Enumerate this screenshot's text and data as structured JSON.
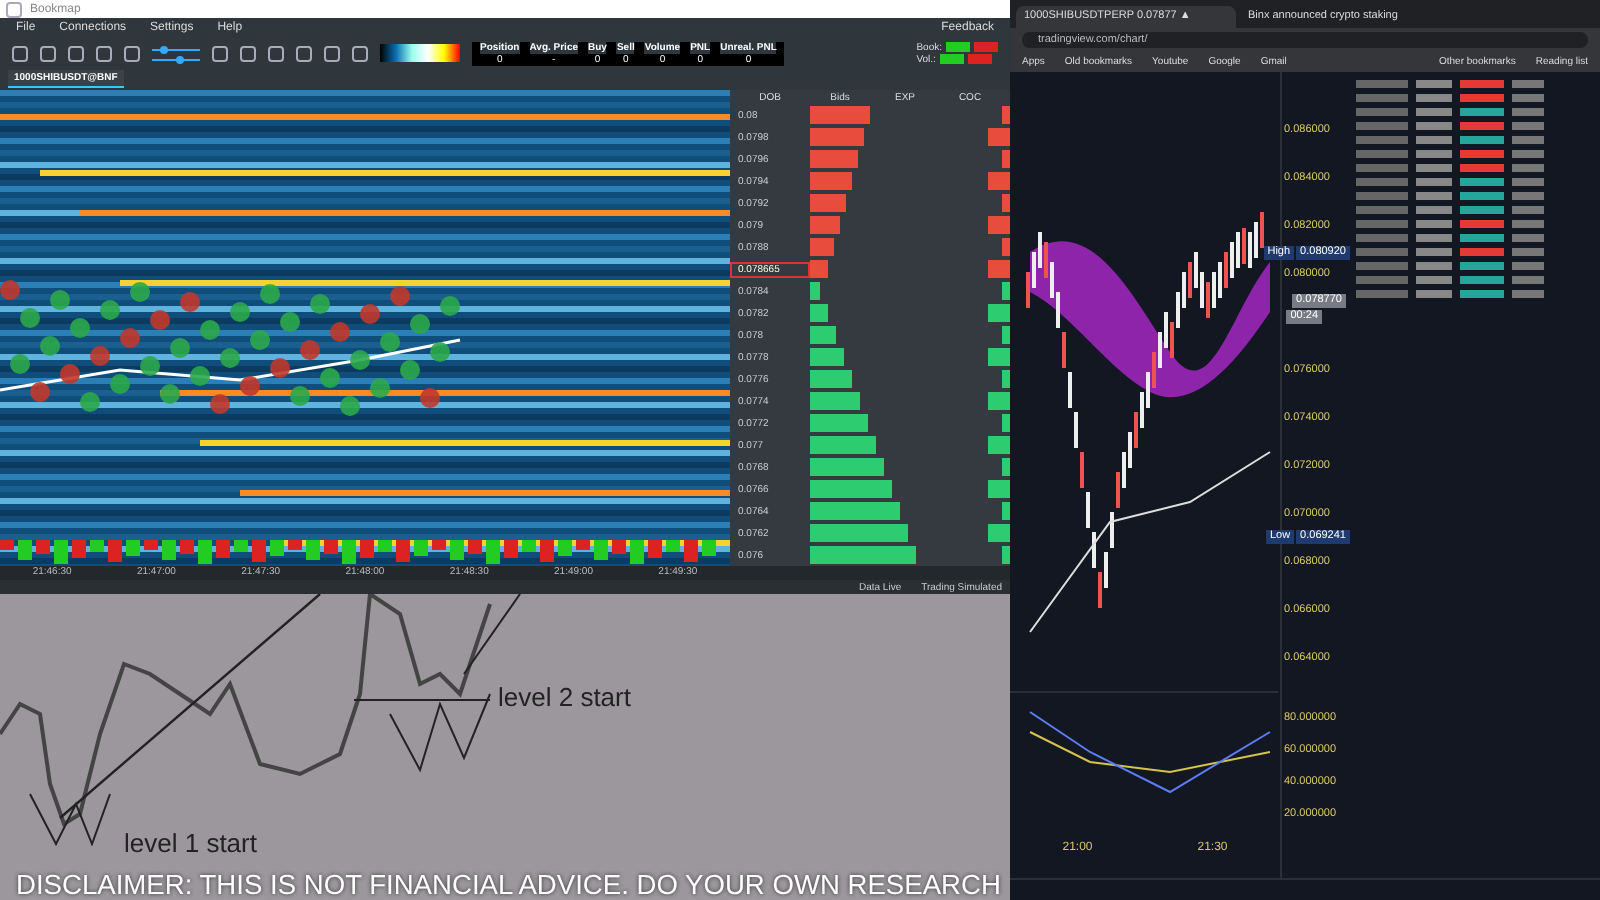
{
  "bookmap": {
    "window": {
      "title": "Bookmap"
    },
    "menu": [
      "File",
      "Connections",
      "Settings",
      "Help"
    ],
    "feedback": "Feedback",
    "position_table": {
      "columns": [
        "Position",
        "Avg. Price",
        "Buy",
        "Sell",
        "Volume",
        "PNL",
        "Unreal. PNL"
      ],
      "values": [
        "0",
        "-",
        "0",
        "0",
        "0",
        "0",
        "0"
      ]
    },
    "book_labels": [
      "Book:",
      "Vol.:"
    ],
    "tabs": [
      {
        "label": "1000SHIBUSDT@BNF",
        "selected": true
      }
    ],
    "ladder": {
      "columns": [
        "DOB",
        "Bids",
        "EXP",
        "COC"
      ],
      "rows": [
        {
          "price": "0.08",
          "highlighted": false
        },
        {
          "price": "0.0798",
          "highlighted": false
        },
        {
          "price": "0.0796",
          "highlighted": false
        },
        {
          "price": "0.0794",
          "highlighted": false
        },
        {
          "price": "0.0792",
          "highlighted": false
        },
        {
          "price": "0.079",
          "highlighted": false
        },
        {
          "price": "0.0788",
          "highlighted": false
        },
        {
          "price": "0.078665",
          "highlighted": true
        },
        {
          "price": "0.0784",
          "highlighted": false
        },
        {
          "price": "0.0782",
          "highlighted": false
        },
        {
          "price": "0.078",
          "highlighted": false
        },
        {
          "price": "0.0778",
          "highlighted": false
        },
        {
          "price": "0.0776",
          "highlighted": false
        },
        {
          "price": "0.0774",
          "highlighted": false
        },
        {
          "price": "0.0772",
          "highlighted": false
        },
        {
          "price": "0.077",
          "highlighted": false
        },
        {
          "price": "0.0768",
          "highlighted": false
        },
        {
          "price": "0.0766",
          "highlighted": false
        },
        {
          "price": "0.0764",
          "highlighted": false
        },
        {
          "price": "0.0762",
          "highlighted": false
        },
        {
          "price": "0.076",
          "highlighted": false
        }
      ]
    },
    "time_axis": [
      "21:46:30",
      "21:47:00",
      "21:47:30",
      "21:48:00",
      "21:48:30",
      "21:49:00",
      "21:49:30"
    ],
    "status_bar": [
      "Data Live",
      "Trading Simulated"
    ]
  },
  "annotation": {
    "labels": [
      "level 2 start",
      "level 1 start"
    ],
    "disclaimer": "DISCLAIMER: THIS IS NOT FINANCIAL ADVICE. DO YOUR OWN RESEARCH"
  },
  "browser": {
    "tabs": [
      {
        "label": "1000SHIBUSDTPERP 0.07877 ▲",
        "selected": true
      },
      {
        "label": "Binx announced crypto staking",
        "selected": false
      }
    ],
    "address": "tradingview.com/chart/",
    "bookmarks": [
      "Apps",
      "Old bookmarks",
      "Youtube",
      "Google",
      "Gmail"
    ],
    "bookmarks_right": [
      "Other bookmarks",
      "Reading list"
    ],
    "chart": {
      "price_axis": [
        "0.086000",
        "0.084000",
        "0.082000",
        "0.080000",
        "0.076000",
        "0.074000",
        "0.072000",
        "0.070000",
        "0.068000",
        "0.066000",
        "0.064000"
      ],
      "high": {
        "label": "High",
        "value": "0.080920"
      },
      "low": {
        "label": "Low",
        "value": "0.069241"
      },
      "current": {
        "value": "0.078770",
        "countdown": "00:24"
      },
      "indicator_axis": [
        "80.000000",
        "60.000000",
        "40.000000",
        "20.000000"
      ],
      "time_axis": [
        "21:00",
        "21:30"
      ]
    }
  }
}
